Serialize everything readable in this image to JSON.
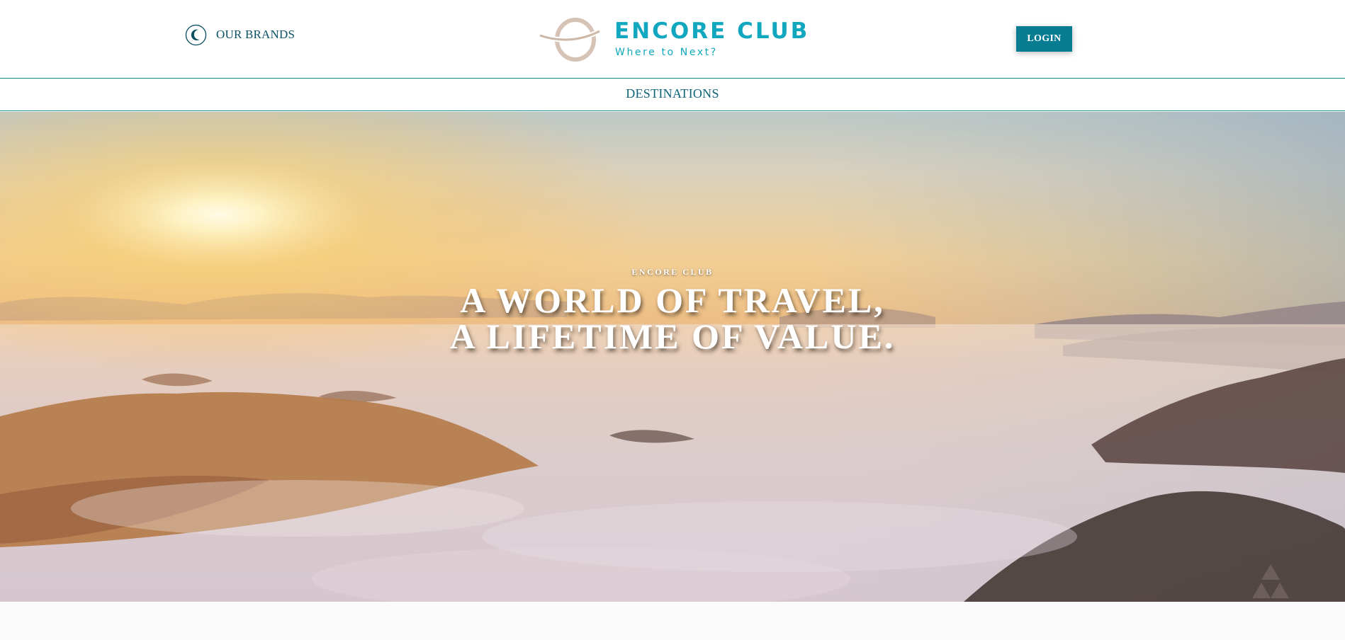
{
  "header": {
    "brands_label": "OUR BRANDS",
    "brands_icon": "crescent-logo-icon",
    "logo_title": "ENCORE CLUB",
    "logo_tagline": "Where to Next?",
    "login_label": "LOGIN"
  },
  "nav": {
    "items": [
      {
        "label": "DESTINATIONS"
      }
    ]
  },
  "hero": {
    "kicker": "ENCORE CLUB",
    "title_line1": "A WORLD OF TRAVEL,",
    "title_line2": "A LIFETIME OF VALUE.",
    "background": "sunrise-over-clouds-mountains",
    "watermark_icon": "triangle-watermark-icon"
  },
  "colors": {
    "brand_teal": "#11a8bf",
    "button_teal": "#087d92",
    "nav_text": "#0e6377",
    "nav_border": "#1f8c9b"
  }
}
